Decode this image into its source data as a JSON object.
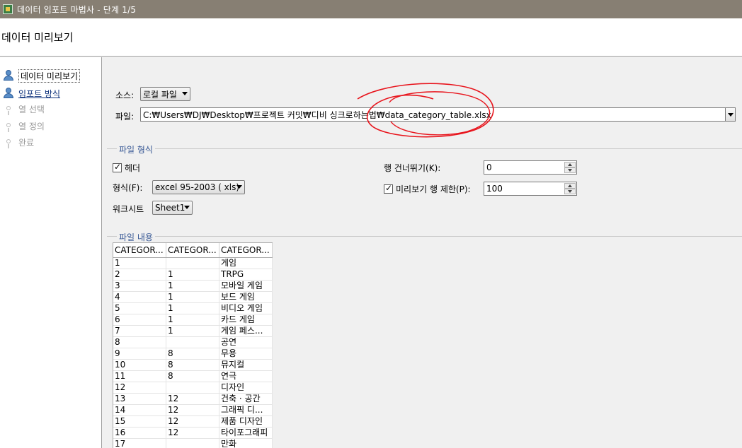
{
  "window": {
    "title": "데이터 임포트 마법사 - 단계 1/5"
  },
  "header": {
    "title": "데이터 미리보기"
  },
  "steps": [
    {
      "label": "데이터 미리보기",
      "state": "active"
    },
    {
      "label": "임포트 방식",
      "state": "done"
    },
    {
      "label": "열 선택",
      "state": "pending"
    },
    {
      "label": "열 정의",
      "state": "pending"
    },
    {
      "label": "완료",
      "state": "pending"
    }
  ],
  "source": {
    "label": "소스:",
    "value": "로컬 파일"
  },
  "file": {
    "label": "파일:",
    "path": "C:₩Users₩DJ₩Desktop₩프로젝트 커밋₩디비 싱크로하는법₩data_category_table.xlsx"
  },
  "file_format": {
    "legend": "파일 형식",
    "header_checkbox": {
      "label": "헤더",
      "checked": true
    },
    "format": {
      "label": "형식(F):",
      "value": "excel 95-2003 ( xls)"
    },
    "worksheet": {
      "label": "워크시트",
      "value": "Sheet1"
    },
    "skip_rows": {
      "label": "행 건너뛰기(K):",
      "value": "0"
    },
    "preview_limit": {
      "label": "미리보기 행 제한(P):",
      "checked": true,
      "value": "100"
    }
  },
  "file_content": {
    "legend": "파일 내용",
    "columns": [
      "CATEGOR...",
      "CATEGOR...",
      "CATEGOR..."
    ],
    "rows": [
      [
        "1",
        "",
        "게임"
      ],
      [
        "2",
        "1",
        "TRPG"
      ],
      [
        "3",
        "1",
        "모바일 게임"
      ],
      [
        "4",
        "1",
        "보드 게임"
      ],
      [
        "5",
        "1",
        "비디오 게임"
      ],
      [
        "6",
        "1",
        "카드 게임"
      ],
      [
        "7",
        "1",
        "게임 페스..."
      ],
      [
        "8",
        "",
        "공연"
      ],
      [
        "9",
        "8",
        "무용"
      ],
      [
        "10",
        "8",
        "뮤지컬"
      ],
      [
        "11",
        "8",
        "연극"
      ],
      [
        "12",
        "",
        "디자인"
      ],
      [
        "13",
        "12",
        "건축 · 공간"
      ],
      [
        "14",
        "12",
        "그래픽 디..."
      ],
      [
        "15",
        "12",
        "제품 디자인"
      ],
      [
        "16",
        "12",
        "타이포그래피"
      ],
      [
        "17",
        "",
        "만화"
      ]
    ]
  },
  "annotation_color": "#e8141c"
}
